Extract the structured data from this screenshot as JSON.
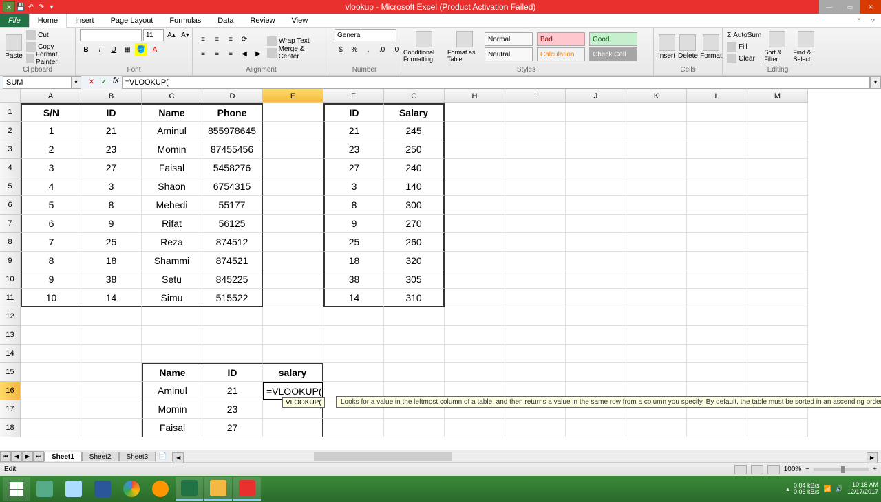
{
  "title": "vlookup - Microsoft Excel (Product Activation Failed)",
  "qat": {
    "save": "💾",
    "undo": "↶",
    "redo": "↷"
  },
  "tabs": [
    "File",
    "Home",
    "Insert",
    "Page Layout",
    "Formulas",
    "Data",
    "Review",
    "View"
  ],
  "ribbon": {
    "clipboard": {
      "label": "Clipboard",
      "paste": "Paste",
      "cut": "Cut",
      "copy": "Copy",
      "format_painter": "Format Painter"
    },
    "font": {
      "label": "Font",
      "name": "",
      "size": "11"
    },
    "alignment": {
      "label": "Alignment",
      "wrap": "Wrap Text",
      "merge": "Merge & Center"
    },
    "number": {
      "label": "Number",
      "format": "General"
    },
    "styles": {
      "label": "Styles",
      "conditional": "Conditional Formatting",
      "as_table": "Format as Table",
      "normal": "Normal",
      "bad": "Bad",
      "good": "Good",
      "neutral": "Neutral",
      "calculation": "Calculation",
      "check": "Check Cell"
    },
    "cells": {
      "label": "Cells",
      "insert": "Insert",
      "delete": "Delete",
      "format": "Format"
    },
    "editing": {
      "label": "Editing",
      "autosum": "AutoSum",
      "fill": "Fill",
      "clear": "Clear",
      "sort": "Sort & Filter",
      "find": "Find & Select"
    }
  },
  "name_box": "SUM",
  "formula": "=VLOOKUP(",
  "columns": [
    "A",
    "B",
    "C",
    "D",
    "E",
    "F",
    "G",
    "H",
    "I",
    "J",
    "K",
    "L",
    "M"
  ],
  "table1": {
    "headers": [
      "S/N",
      "ID",
      "Name",
      "Phone"
    ],
    "rows": [
      [
        "1",
        "21",
        "Aminul",
        "855978645"
      ],
      [
        "2",
        "23",
        "Momin",
        "87455456"
      ],
      [
        "3",
        "27",
        "Faisal",
        "5458276"
      ],
      [
        "4",
        "3",
        "Shaon",
        "6754315"
      ],
      [
        "5",
        "8",
        "Mehedi",
        "55177"
      ],
      [
        "6",
        "9",
        "Rifat",
        "56125"
      ],
      [
        "7",
        "25",
        "Reza",
        "874512"
      ],
      [
        "8",
        "18",
        "Shammi",
        "874521"
      ],
      [
        "9",
        "38",
        "Setu",
        "845225"
      ],
      [
        "10",
        "14",
        "Simu",
        "515522"
      ]
    ]
  },
  "table2": {
    "headers": [
      "ID",
      "Salary"
    ],
    "rows": [
      [
        "21",
        "245"
      ],
      [
        "23",
        "250"
      ],
      [
        "27",
        "240"
      ],
      [
        "3",
        "140"
      ],
      [
        "8",
        "300"
      ],
      [
        "9",
        "270"
      ],
      [
        "25",
        "260"
      ],
      [
        "18",
        "320"
      ],
      [
        "38",
        "305"
      ],
      [
        "14",
        "310"
      ]
    ]
  },
  "table3": {
    "headers": [
      "Name",
      "ID",
      "salary"
    ],
    "rows": [
      [
        "Aminul",
        "21",
        "=VLOOKUP("
      ],
      [
        "Momin",
        "23",
        ""
      ],
      [
        "Faisal",
        "27",
        ""
      ]
    ]
  },
  "tooltip_arg": "VLOOKUP(",
  "tooltip_desc": "Looks for a value in the leftmost column of a table, and then returns a value in the same row from a column you specify. By default, the table must be sorted in an ascending order",
  "sheets": [
    "Sheet1",
    "Sheet2",
    "Sheet3"
  ],
  "status": "Edit",
  "zoom": "100%",
  "tray": {
    "net": "0.04 kB/s",
    "net2": "0.06 kB/s",
    "time": "10:18 AM",
    "date": "12/17/2017"
  }
}
